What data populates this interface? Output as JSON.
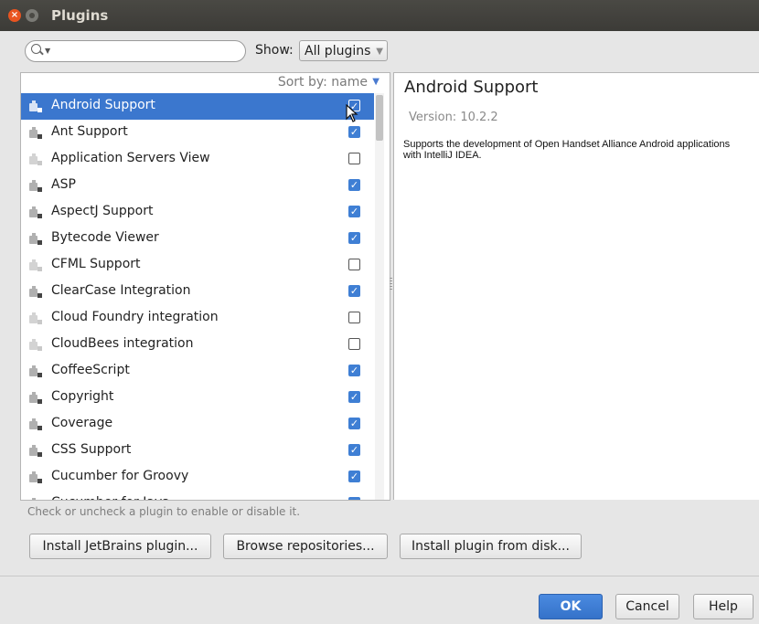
{
  "window": {
    "title": "Plugins"
  },
  "toolbar": {
    "search_placeholder": "",
    "show_label": "Show:",
    "show_value": "All plugins"
  },
  "list": {
    "sort_label": "Sort by: name",
    "plugins": [
      {
        "name": "Android Support",
        "enabled": true,
        "selected": true
      },
      {
        "name": "Ant Support",
        "enabled": true,
        "selected": false
      },
      {
        "name": "Application Servers View",
        "enabled": false,
        "selected": false
      },
      {
        "name": "ASP",
        "enabled": true,
        "selected": false
      },
      {
        "name": "AspectJ Support",
        "enabled": true,
        "selected": false
      },
      {
        "name": "Bytecode Viewer",
        "enabled": true,
        "selected": false
      },
      {
        "name": "CFML Support",
        "enabled": false,
        "selected": false
      },
      {
        "name": "ClearCase Integration",
        "enabled": true,
        "selected": false
      },
      {
        "name": "Cloud Foundry integration",
        "enabled": false,
        "selected": false
      },
      {
        "name": "CloudBees integration",
        "enabled": false,
        "selected": false
      },
      {
        "name": "CoffeeScript",
        "enabled": true,
        "selected": false
      },
      {
        "name": "Copyright",
        "enabled": true,
        "selected": false
      },
      {
        "name": "Coverage",
        "enabled": true,
        "selected": false
      },
      {
        "name": "CSS Support",
        "enabled": true,
        "selected": false
      },
      {
        "name": "Cucumber for Groovy",
        "enabled": true,
        "selected": false
      },
      {
        "name": "Cucumber for Java",
        "enabled": true,
        "selected": false
      }
    ]
  },
  "details": {
    "title": "Android Support",
    "version": "Version: 10.2.2",
    "description": "Supports the development of Open Handset Alliance Android applications with IntelliJ IDEA."
  },
  "hint": "Check or uncheck a plugin to enable or disable it.",
  "actions": {
    "install_jetbrains": "Install JetBrains plugin...",
    "browse": "Browse repositories...",
    "install_disk": "Install plugin from disk..."
  },
  "footer": {
    "ok": "OK",
    "cancel": "Cancel",
    "help": "Help"
  },
  "colors": {
    "selection": "#3b77ce",
    "accent": "#3f7fd4",
    "titlebar": "#3c3b37",
    "close": "#e95420"
  }
}
